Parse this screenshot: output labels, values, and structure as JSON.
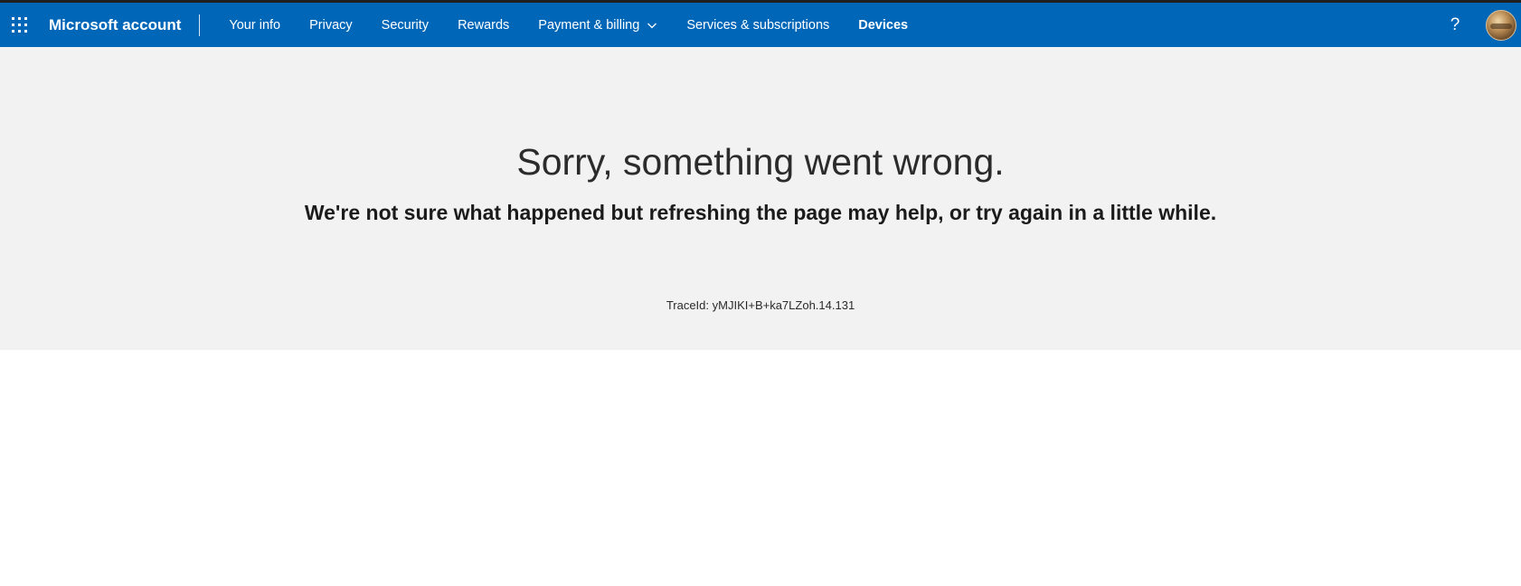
{
  "header": {
    "brand": "Microsoft account",
    "nav": [
      {
        "label": "Your info"
      },
      {
        "label": "Privacy"
      },
      {
        "label": "Security"
      },
      {
        "label": "Rewards"
      },
      {
        "label": "Payment & billing",
        "has_dropdown": true
      },
      {
        "label": "Services & subscriptions"
      },
      {
        "label": "Devices",
        "active": true
      }
    ],
    "help_glyph": "?",
    "icons": {
      "apps": "waffle-icon",
      "dropdown": "chevron-down-icon",
      "help": "help-icon",
      "profile": "avatar"
    }
  },
  "error": {
    "title": "Sorry, something went wrong.",
    "subtitle": "We're not sure what happened but refreshing the page may help, or try again in a little while.",
    "trace": "TraceId: yMJIKI+B+ka7LZoh.14.131"
  },
  "colors": {
    "nav_bg": "#0067b8",
    "panel_bg": "#f2f2f2",
    "text": "#2b2b2b"
  }
}
